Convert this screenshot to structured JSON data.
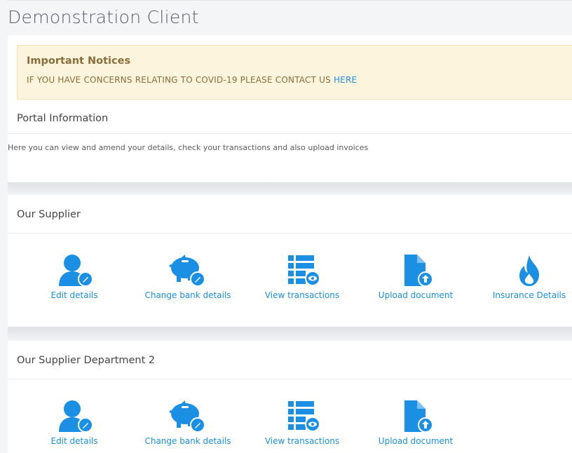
{
  "header": {
    "title": "Demonstration Client"
  },
  "notice": {
    "title": "Important Notices",
    "message": "IF YOU HAVE CONCERNS RELATING TO COVID-19 PLEASE CONTACT US ",
    "link": "HERE"
  },
  "portal": {
    "title": "Portal Information",
    "text": "Here you can view and amend your details, check your transactions and also upload invoices"
  },
  "sections": [
    {
      "title": "Our Supplier",
      "actions": [
        {
          "label": "Edit details",
          "icon": "user-edit-icon"
        },
        {
          "label": "Change bank details",
          "icon": "piggy-bank-edit-icon"
        },
        {
          "label": "View transactions",
          "icon": "list-view-icon"
        },
        {
          "label": "Upload document",
          "icon": "document-upload-icon"
        },
        {
          "label": "Insurance Details",
          "icon": "fire-icon"
        }
      ]
    },
    {
      "title": "Our Supplier Department 2",
      "actions": [
        {
          "label": "Edit details",
          "icon": "user-edit-icon"
        },
        {
          "label": "Change bank details",
          "icon": "piggy-bank-edit-icon"
        },
        {
          "label": "View transactions",
          "icon": "list-view-icon"
        },
        {
          "label": "Upload document",
          "icon": "document-upload-icon"
        }
      ]
    }
  ],
  "colors": {
    "accent": "#1a8fe3",
    "notice_bg": "#fcf4dd",
    "notice_text": "#8a6d3b"
  }
}
